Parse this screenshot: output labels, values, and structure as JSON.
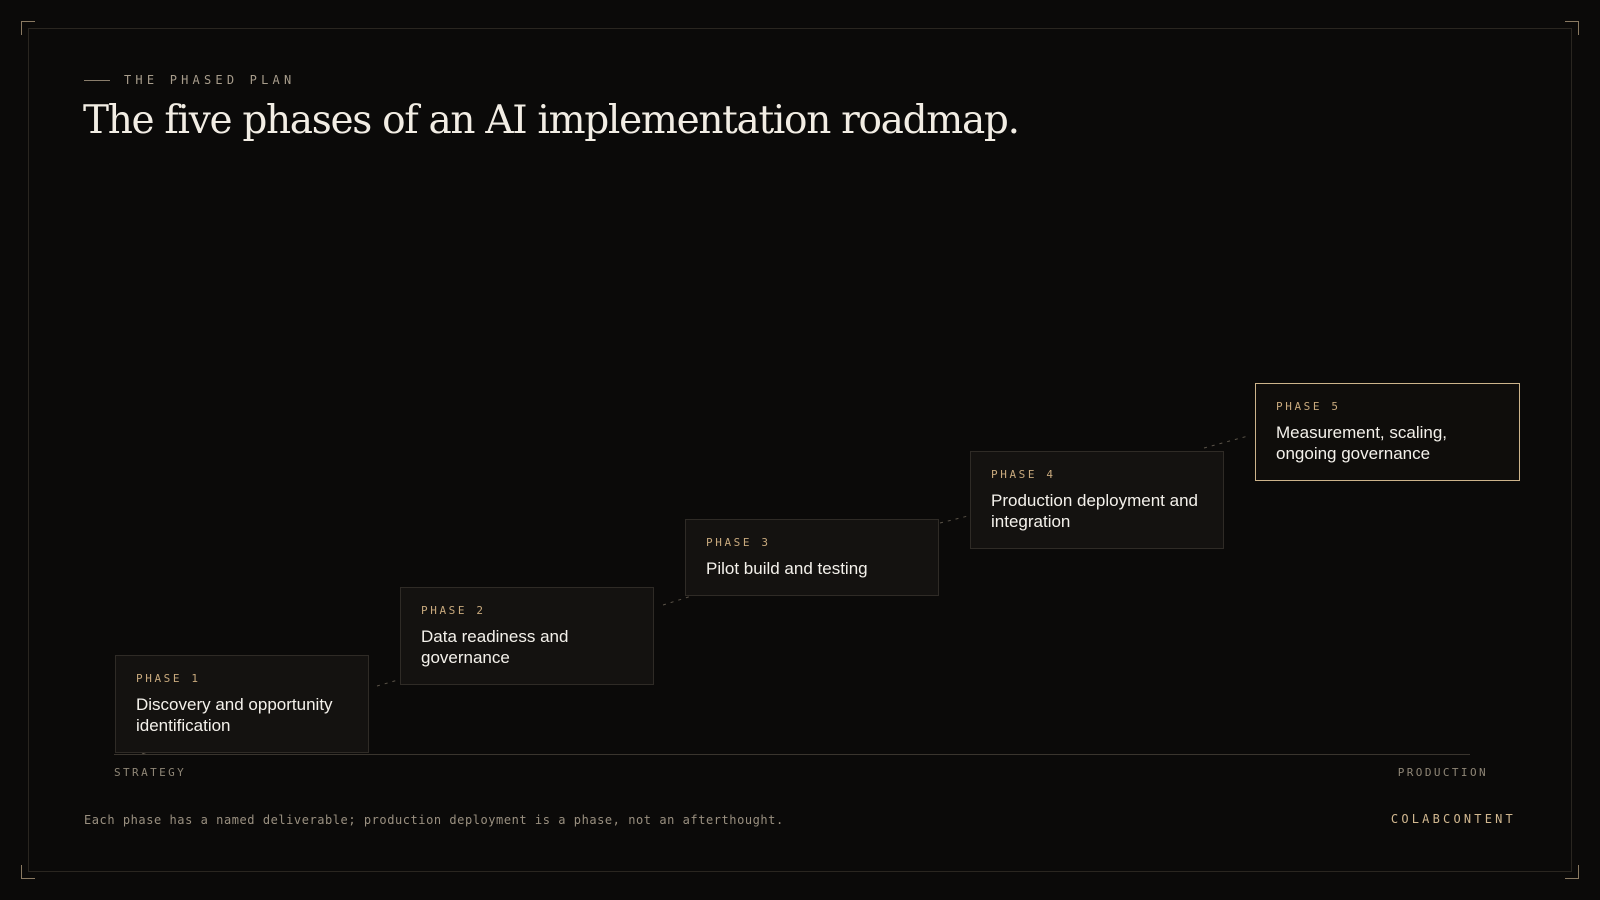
{
  "eyebrow": "THE PHASED PLAN",
  "title": "The five phases of an AI implementation roadmap.",
  "phases": [
    {
      "label": "PHASE 1",
      "title": "Discovery and opportunity identification",
      "step": 1
    },
    {
      "label": "PHASE 2",
      "title": "Data readiness and governance",
      "step": 2
    },
    {
      "label": "PHASE 3",
      "title": "Pilot build and testing",
      "step": 3
    },
    {
      "label": "PHASE 4",
      "title": "Production deployment and integration",
      "step": 4
    },
    {
      "label": "PHASE 5",
      "title": "Measurement, scaling, ongoing governance",
      "step": 5,
      "highlighted": true
    }
  ],
  "axis": {
    "start_label": "STRATEGY",
    "end_label": "PRODUCTION"
  },
  "footnote": "Each phase has a named deliverable; production deployment is a phase, not an afterthought.",
  "brand": "COLABCONTENT",
  "colors": {
    "background": "#0b0a09",
    "accent": "#cdb48b",
    "text": "#f2ede4"
  }
}
